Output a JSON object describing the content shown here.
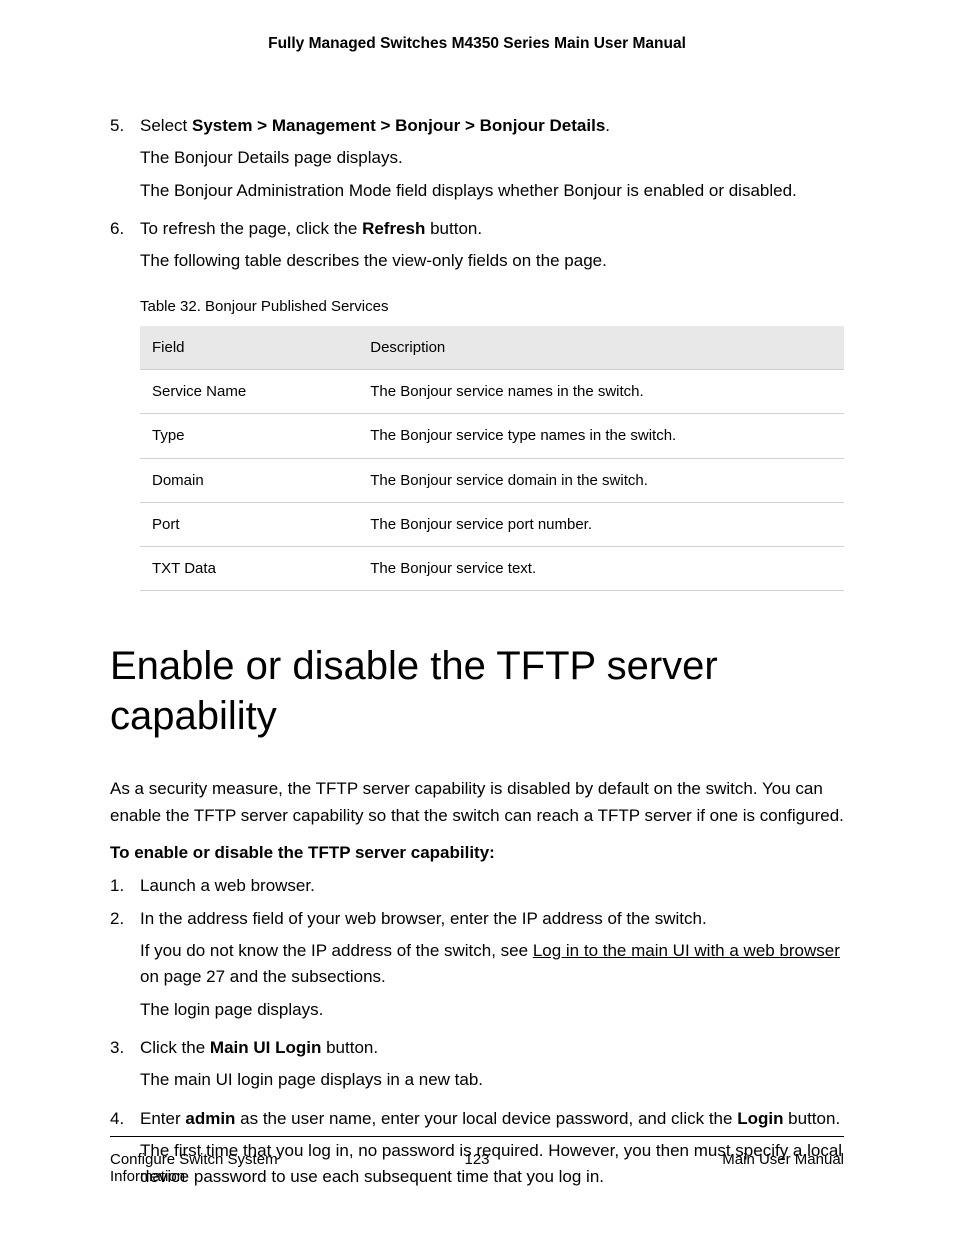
{
  "header": {
    "title": "Fully Managed Switches M4350 Series Main User Manual"
  },
  "list1": {
    "item5": {
      "num": "5.",
      "pre": "Select ",
      "bold": "System > Management > Bonjour > Bonjour Details",
      "post": ".",
      "sub1": "The Bonjour Details page displays.",
      "sub2": "The Bonjour Administration Mode field displays whether Bonjour is enabled or disabled."
    },
    "item6": {
      "num": "6.",
      "pre": "To refresh the page, click the ",
      "bold": "Refresh",
      "post": " button.",
      "sub1": "The following table describes the view-only fields on the page."
    }
  },
  "table": {
    "caption": "Table 32. Bonjour Published Services",
    "headers": {
      "field": "Field",
      "desc": "Description"
    },
    "rows": [
      {
        "field": "Service Name",
        "desc": "The Bonjour service names in the switch."
      },
      {
        "field": "Type",
        "desc": "The Bonjour service type names in the switch."
      },
      {
        "field": "Domain",
        "desc": "The Bonjour service domain in the switch."
      },
      {
        "field": "Port",
        "desc": "The Bonjour service port number."
      },
      {
        "field": "TXT Data",
        "desc": "The Bonjour service text."
      }
    ]
  },
  "heading": "Enable or disable the TFTP server capability",
  "intro": "As a security measure, the TFTP server capability is disabled by default on the switch. You can enable the TFTP server capability so that the switch can reach a TFTP server if one is configured.",
  "subhead": "To enable or disable the TFTP server capability:",
  "list2": {
    "item1": {
      "num": "1.",
      "text": "Launch a web browser."
    },
    "item2": {
      "num": "2.",
      "text": "In the address field of your web browser, enter the IP address of the switch.",
      "sub1_pre": "If you do not know the IP address of the switch, see ",
      "sub1_link": "Log in to the main UI with a web browser",
      "sub1_post": " on page 27 and the subsections.",
      "sub2": "The login page displays."
    },
    "item3": {
      "num": "3.",
      "pre": "Click the ",
      "bold": "Main UI Login",
      "post": " button.",
      "sub1": "The main UI login page displays in a new tab."
    },
    "item4": {
      "num": "4.",
      "pre": "Enter ",
      "bold1": "admin",
      "mid": " as the user name, enter your local device password, and click the ",
      "bold2": "Login",
      "post": " button.",
      "sub1": "The first time that you log in, no password is required. However, you then must specify a local device password to use each subsequent time that you log in."
    }
  },
  "footer": {
    "left": "Configure Switch System Information",
    "center": "123",
    "right": "Main User Manual"
  }
}
